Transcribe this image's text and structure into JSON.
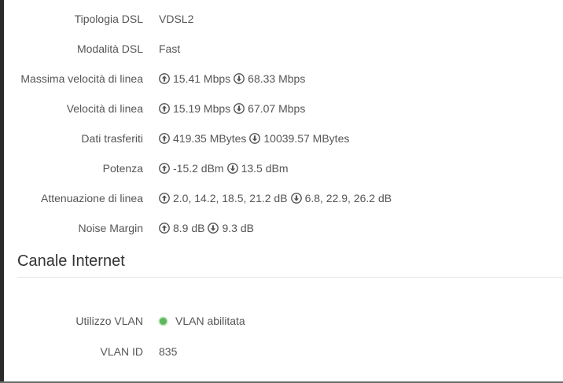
{
  "dsl": {
    "typology": {
      "label": "Tipologia DSL",
      "value": "VDSL2"
    },
    "mode": {
      "label": "Modalità DSL",
      "value": "Fast"
    },
    "max_speed": {
      "label": "Massima velocità di linea",
      "up": "15.41 Mbps",
      "down": "68.33 Mbps"
    },
    "speed": {
      "label": "Velocità di linea",
      "up": "15.19 Mbps",
      "down": "67.07 Mbps"
    },
    "data_transferred": {
      "label": "Dati trasferiti",
      "up": "419.35 MBytes",
      "down": "10039.57 MBytes"
    },
    "power": {
      "label": "Potenza",
      "up": "-15.2 dBm",
      "down": "13.5 dBm"
    },
    "attenuation": {
      "label": "Attenuazione di linea",
      "up": "2.0, 14.2, 18.5, 21.2 dB",
      "down": "6.8, 22.9, 26.2 dB"
    },
    "noise_margin": {
      "label": "Noise Margin",
      "up": "8.9 dB",
      "down": "9.3 dB"
    }
  },
  "internet_channel": {
    "title": "Canale Internet",
    "vlan_usage": {
      "label": "Utilizzo VLAN",
      "value": "VLAN abilitata",
      "status_color": "#5cb85c"
    },
    "vlan_id": {
      "label": "VLAN ID",
      "value": "835"
    }
  },
  "icons": {
    "up": "arrow-up-circle-icon",
    "down": "arrow-down-circle-icon"
  }
}
